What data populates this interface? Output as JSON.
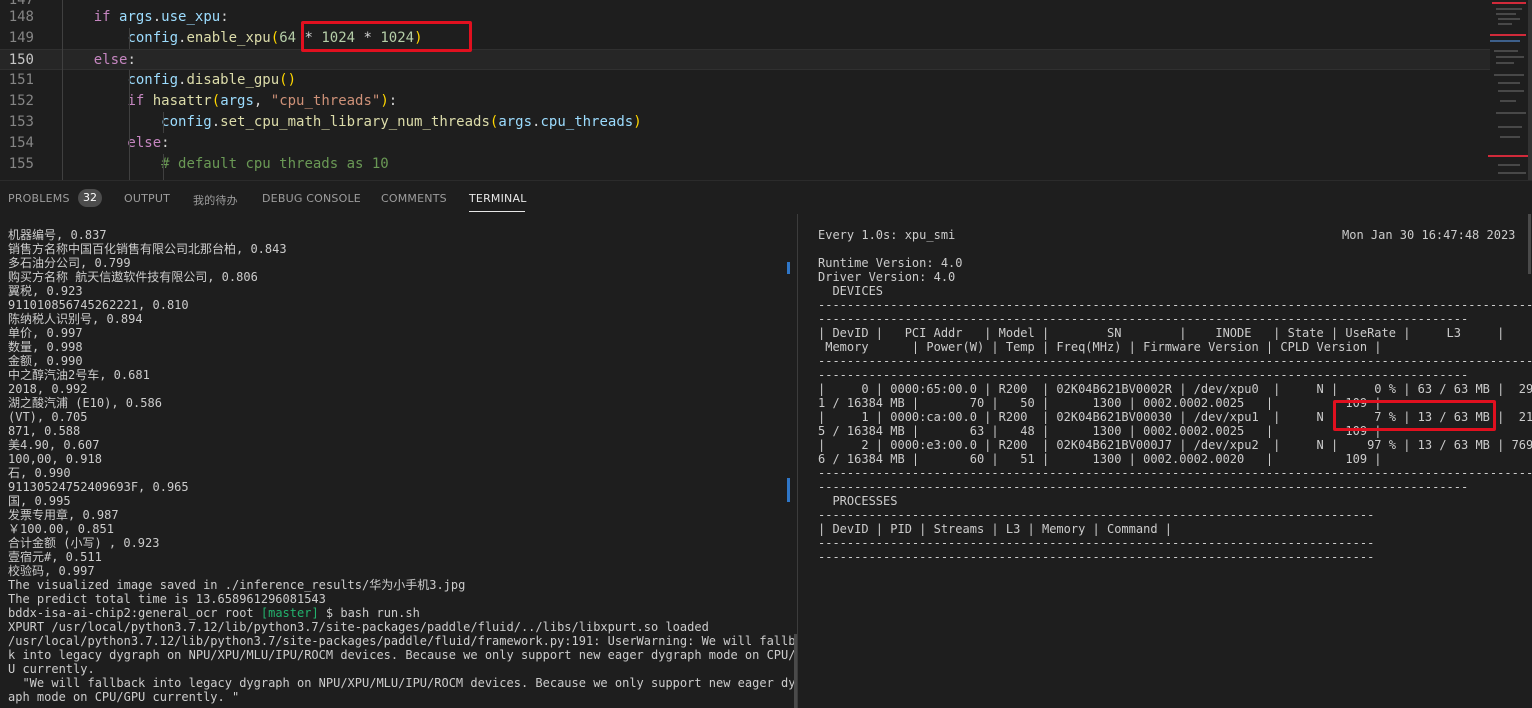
{
  "editor": {
    "lines": [
      {
        "num": "147",
        "text": ""
      },
      {
        "num": "148",
        "text": "    if args.use_xpu:"
      },
      {
        "num": "149",
        "text": "        config.enable_xpu(64 * 1024 * 1024)"
      },
      {
        "num": "150",
        "text": "    else:"
      },
      {
        "num": "151",
        "text": "        config.disable_gpu()"
      },
      {
        "num": "152",
        "text": "        if hasattr(args, \"cpu_threads\"):"
      },
      {
        "num": "153",
        "text": "            config.set_cpu_math_library_num_threads(args.cpu_threads)"
      },
      {
        "num": "154",
        "text": "        else:"
      },
      {
        "num": "155",
        "text": "            # default cpu threads as 10"
      }
    ],
    "current_line": "150"
  },
  "panel": {
    "tabs": [
      {
        "label": "PROBLEMS",
        "badge": "32"
      },
      {
        "label": "OUTPUT"
      },
      {
        "label": "我的待办"
      },
      {
        "label": "DEBUG CONSOLE"
      },
      {
        "label": "COMMENTS"
      },
      {
        "label": "TERMINAL",
        "active": true
      }
    ]
  },
  "terminal_left": {
    "lines": [
      "机器编号, 0.837",
      "销售方名称中国百化销售有限公司北那台柏, 0.843",
      "多石油分公司, 0.799",
      "购买方名称 航天信遨软件技有限公司, 0.806",
      "翼税, 0.923",
      "911010856745262221, 0.810",
      "陈纳税人识别号, 0.894",
      "单价, 0.997",
      "数量, 0.998",
      "金额, 0.990",
      "中之醇汽油2号车, 0.681",
      "2018, 0.992",
      "湖之酸汽浦 (E10), 0.586",
      "(VT), 0.705",
      "871, 0.588",
      "美4.90, 0.607",
      "100,00, 0.918",
      "石, 0.990",
      "91130524752409693F, 0.965",
      "国, 0.995",
      "发票专用章, 0.987",
      "￥100.00, 0.851",
      "合计金额 (小写) , 0.923",
      "壹宿元#, 0.511",
      "校验码, 0.997",
      "The visualized image saved in ./inference_results/华为小手机3.jpg",
      "The predict total time is 13.658961296081543",
      "",
      "XPURT /usr/local/python3.7.12/lib/python3.7/site-packages/paddle/fluid/../libs/libxpurt.so loaded",
      "/usr/local/python3.7.12/lib/python3.7/site-packages/paddle/fluid/framework.py:191: UserWarning: We will fallbac",
      "k into legacy dygraph on NPU/XPU/MLU/IPU/ROCM devices. Because we only support new eager dygraph mode on CPU/GP",
      "U currently.",
      "  \"We will fallback into legacy dygraph on NPU/XPU/MLU/IPU/ROCM devices. Because we only support new eager dygr",
      "aph mode on CPU/GPU currently. \""
    ],
    "prompt": {
      "host": "bddx-isa-ai-chip2:general_ocr root ",
      "branch": "[master]",
      "command": " $ bash run.sh"
    }
  },
  "terminal_right": {
    "header_left": "Every 1.0s: xpu_smi",
    "header_right": "Mon Jan 30 16:47:48 2023",
    "lines": [
      "",
      "Runtime Version: 4.0",
      "Driver Version: 4.0",
      "  DEVICES",
      "----------------------------------------------------------------------------------------------------------",
      "------------------------------------------------------------------------------------------",
      "| DevID |   PCI Addr   | Model |        SN        |    INODE   | State | UseRate |     L3     |",
      " Memory      | Power(W) | Temp | Freq(MHz) | Firmware Version | CPLD Version |",
      "----------------------------------------------------------------------------------------------------------",
      "------------------------------------------------------------------------------------------",
      "|     0 | 0000:65:00.0 | R200  | 02K04B621BV0002R | /dev/xpu0  |     N |     0 % | 63 / 63 MB |  29",
      "1 / 16384 MB |       70 |   50 |      1300 | 0002.0002.0025   |          109 |",
      "|     1 | 0000:ca:00.0 | R200  | 02K04B621BV00030 | /dev/xpu1  |     N |     7 % | 13 / 63 MB |  21",
      "5 / 16384 MB |       63 |   48 |      1300 | 0002.0002.0025   |          109 |",
      "|     2 | 0000:e3:00.0 | R200  | 02K04B621BV000J7 | /dev/xpu2  |     N |    97 % | 13 / 63 MB | 769",
      "6 / 16384 MB |       60 |   51 |      1300 | 0002.0002.0020   |          109 |",
      "----------------------------------------------------------------------------------------------------------",
      "------------------------------------------------------------------------------------------",
      "  PROCESSES",
      "-----------------------------------------------------------------------------",
      "| DevID | PID | Streams | L3 | Memory | Command |",
      "-----------------------------------------------------------------------------",
      "-----------------------------------------------------------------------------"
    ]
  }
}
